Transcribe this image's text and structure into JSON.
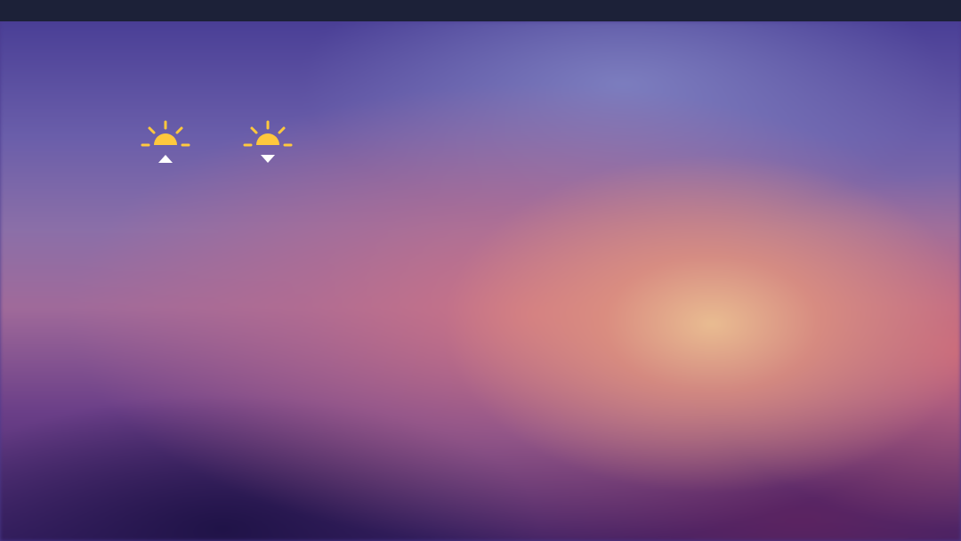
{
  "icons": {
    "sunrise": "sunrise-icon",
    "sunset": "sunset-icon"
  },
  "colors": {
    "sun": "#FFC83D",
    "arrow": "#FFFFFF",
    "topbar": "#1C2138"
  }
}
